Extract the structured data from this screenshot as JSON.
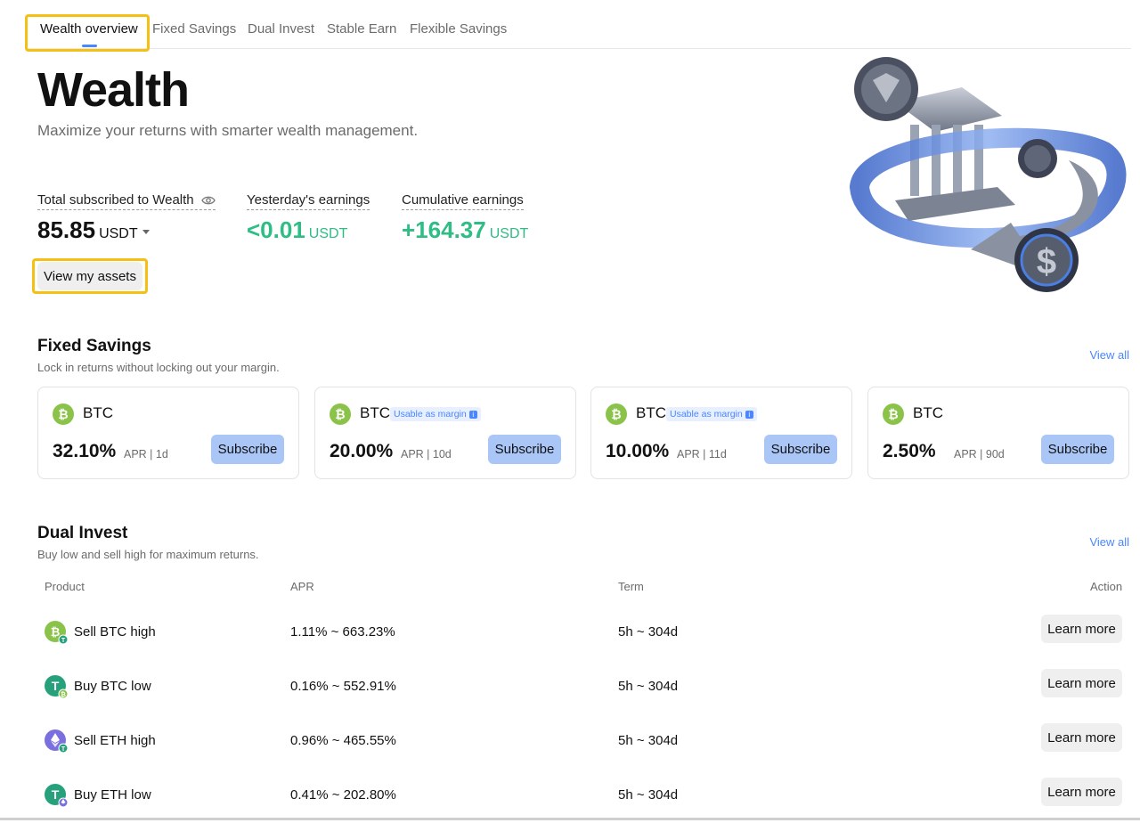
{
  "tabs": [
    {
      "label": "Wealth overview"
    },
    {
      "label": "Fixed Savings"
    },
    {
      "label": "Dual Invest"
    },
    {
      "label": "Stable Earn"
    },
    {
      "label": "Flexible Savings"
    }
  ],
  "hero": {
    "title": "Wealth",
    "subtitle": "Maximize your returns with smarter wealth management."
  },
  "stats": {
    "total": {
      "label": "Total subscribed to Wealth",
      "value": "85.85",
      "unit": "USDT"
    },
    "yesterday": {
      "label": "Yesterday's earnings",
      "value": "<0.01",
      "unit": "USDT"
    },
    "cumulative": {
      "label": "Cumulative earnings",
      "value": "+164.37",
      "unit": "USDT"
    }
  },
  "view_assets_label": "View my assets",
  "fixed_savings": {
    "title": "Fixed Savings",
    "subtitle": "Lock in returns without locking out your margin.",
    "view_all": "View all",
    "cards": [
      {
        "coin": "BTC",
        "badge": "",
        "apr": "32.10%",
        "meta": "APR | 1d",
        "button": "Subscribe"
      },
      {
        "coin": "BTC",
        "badge": "Usable as margin",
        "apr": "20.00%",
        "meta": "APR | 10d",
        "button": "Subscribe"
      },
      {
        "coin": "BTC",
        "badge": "Usable as margin",
        "apr": "10.00%",
        "meta": "APR | 11d",
        "button": "Subscribe"
      },
      {
        "coin": "BTC",
        "badge": "",
        "apr": "2.50%",
        "meta": "APR | 90d",
        "button": "Subscribe"
      }
    ]
  },
  "dual_invest": {
    "title": "Dual Invest",
    "subtitle": "Buy low and sell high for maximum returns.",
    "view_all": "View all",
    "columns": [
      "Product",
      "APR",
      "Term",
      "Action"
    ],
    "rows": [
      {
        "icon": "btc-usdt-icon",
        "product": "Sell BTC high",
        "apr": "1.11% ~ 663.23%",
        "term": "5h ~ 304d",
        "action": "Learn more"
      },
      {
        "icon": "usdt-btc-icon",
        "product": "Buy BTC low",
        "apr": "0.16% ~ 552.91%",
        "term": "5h ~ 304d",
        "action": "Learn more"
      },
      {
        "icon": "eth-usdt-icon",
        "product": "Sell ETH high",
        "apr": "0.96% ~ 465.55%",
        "term": "5h ~ 304d",
        "action": "Learn more"
      },
      {
        "icon": "usdt-eth-icon",
        "product": "Buy ETH low",
        "apr": "0.41% ~ 202.80%",
        "term": "5h ~ 304d",
        "action": "Learn more"
      }
    ]
  },
  "colors": {
    "accent": "#4a86ff",
    "green": "#2ebd85",
    "btc": "#8bc34a",
    "usdt": "#26a17b",
    "eth": "#7b6fe0",
    "highlight": "#f5c014"
  }
}
